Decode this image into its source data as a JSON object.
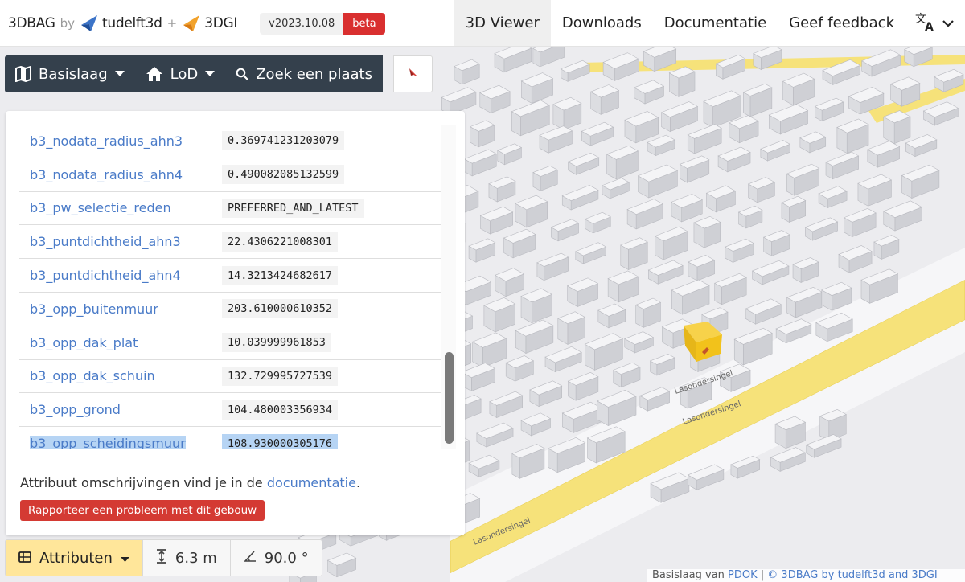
{
  "app": {
    "name": "3DBAG",
    "by": "by",
    "org1": "tudelft3d",
    "plus": "+",
    "org2": "3DGI",
    "version": "v2023.10.08",
    "badge": "beta"
  },
  "nav": {
    "items": [
      "3D Viewer",
      "Downloads",
      "Documentatie",
      "Geef feedback"
    ],
    "active": "3D Viewer",
    "language_icon": "translate-icon"
  },
  "toolbar": {
    "basemap_label": "Basislaag",
    "lod_label": "LoD",
    "search_label": "Zoek een plaats"
  },
  "attributes": {
    "rows": [
      {
        "key": "b3_nodata_radius_ahn3",
        "value": "0.369741231203079"
      },
      {
        "key": "b3_nodata_radius_ahn4",
        "value": "0.490082085132599"
      },
      {
        "key": "b3_pw_selectie_reden",
        "value": "PREFERRED_AND_LATEST"
      },
      {
        "key": "b3_puntdichtheid_ahn3",
        "value": "22.4306221008301"
      },
      {
        "key": "b3_puntdichtheid_ahn4",
        "value": "14.3213424682617"
      },
      {
        "key": "b3_opp_buitenmuur",
        "value": "203.610000610352"
      },
      {
        "key": "b3_opp_dak_plat",
        "value": "10.039999961853"
      },
      {
        "key": "b3_opp_dak_schuin",
        "value": "132.729995727539"
      },
      {
        "key": "b3_opp_grond",
        "value": "104.480003356934"
      },
      {
        "key": "b3_opp_scheidingsmuur",
        "value": "108.930000305176"
      }
    ],
    "selected_row": "b3_opp_scheidingsmuur",
    "note_prefix": "Attribuut omschrijvingen vind je in de",
    "note_link": "documentatie",
    "note_suffix": ".",
    "report_button": "Rapporteer een probleem met dit gebouw"
  },
  "bottom": {
    "attributes_label": "Attributen",
    "height_value": "6.3 m",
    "angle_value": "90.0 °"
  },
  "attribution": {
    "prefix": "Basislaag van",
    "pdok": "PDOK",
    "separator": "|",
    "text": "© 3DBAG by tudelft3d and 3DGI"
  },
  "map": {
    "street_label": "Lasondersingel",
    "colors": {
      "road": "#f6e27a",
      "building_top": "#f4f4f6",
      "building_side": "#cfd0d5",
      "selected": "#f2c21b"
    }
  }
}
